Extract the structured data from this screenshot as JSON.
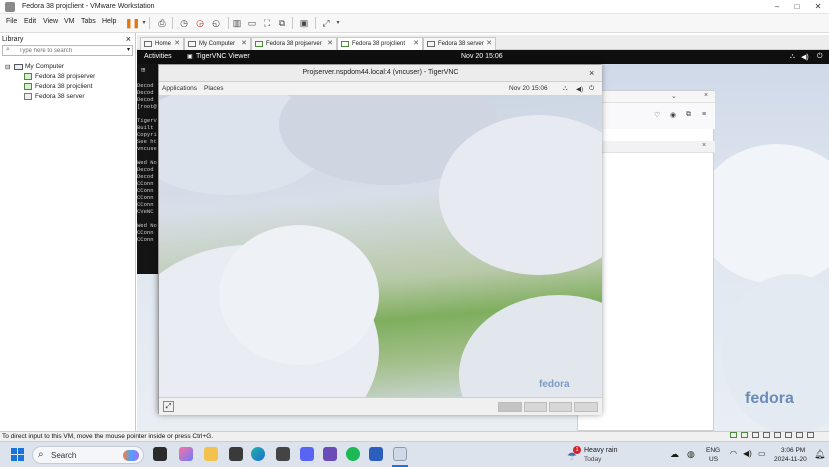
{
  "window": {
    "title": "Fedora 38 projclient - VMware Workstation",
    "min": "–",
    "max": "□",
    "close": "✕"
  },
  "menu": [
    "File",
    "Edit",
    "View",
    "VM",
    "Tabs",
    "Help"
  ],
  "library": {
    "title": "Library",
    "close": "×",
    "search_placeholder": "Type here to search",
    "root": "My Computer",
    "items": [
      "Fedora 38 projserver",
      "Fedora 38 projclient",
      "Fedora 38 server"
    ]
  },
  "tabs": [
    {
      "label": "Home"
    },
    {
      "label": "My Computer"
    },
    {
      "label": "Fedora 38 projserver"
    },
    {
      "label": "Fedora 38 projclient"
    },
    {
      "label": "Fedora 38 server"
    }
  ],
  "tab_close": "✕",
  "guest": {
    "activities": "Activities",
    "app": "TigerVNC Viewer",
    "clock": "Nov 20  15:06",
    "terminal_lines": [
      "Decod",
      "Decod",
      "Decod",
      "[root@",
      "",
      "TigerV",
      "Built",
      "Copyri",
      "See ht",
      "vncuse",
      "",
      "Wed No",
      "Decod",
      "Decod",
      "CConn",
      "CConn",
      "CConn",
      "CConn",
      "CVeNC",
      "",
      "Wed No",
      "CConn",
      "CConn"
    ],
    "fedora_logo": "fedora"
  },
  "vnc": {
    "title": "Projserver.nspdom44.local:4 (vncuser) - TigerVNC",
    "close": "×",
    "applications": "Applications",
    "places": "Places",
    "clock": "Nov 20  15:06",
    "fedora_logo": "fedora"
  },
  "status_text": "To direct input to this VM, move the mouse pointer inside or press Ctrl+G.",
  "taskbar": {
    "search": "Search",
    "weather_title": "Heavy rain",
    "weather_sub": "Today",
    "lang1": "ENG",
    "lang2": "US",
    "time": "3:06 PM",
    "date": "2024-11-20",
    "badge": "1"
  }
}
